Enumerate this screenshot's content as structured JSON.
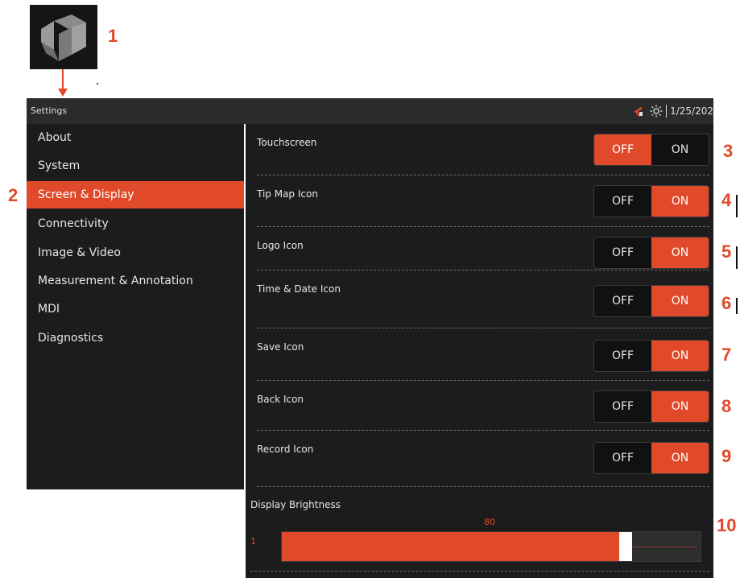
{
  "window": {
    "title": "Settings",
    "date": "1/25/202"
  },
  "callouts": [
    "1",
    "2",
    "3",
    "4",
    "5",
    "6",
    "7",
    "8",
    "9",
    "10"
  ],
  "sidebar": {
    "items": [
      {
        "label": "About"
      },
      {
        "label": "System"
      },
      {
        "label": "Screen & Display",
        "active": true
      },
      {
        "label": "Connectivity"
      },
      {
        "label": "Image & Video"
      },
      {
        "label": "Measurement & Annotation"
      },
      {
        "label": "MDI"
      },
      {
        "label": "Diagnostics"
      }
    ]
  },
  "settings": [
    {
      "label": "Touchscreen",
      "off": "OFF",
      "on": "ON",
      "value": "OFF"
    },
    {
      "label": "Tip Map Icon",
      "off": "OFF",
      "on": "ON",
      "value": "ON"
    },
    {
      "label": "Logo Icon",
      "off": "OFF",
      "on": "ON",
      "value": "ON"
    },
    {
      "label": "Time & Date Icon",
      "off": "OFF",
      "on": "ON",
      "value": "ON"
    },
    {
      "label": "Save Icon",
      "off": "OFF",
      "on": "ON",
      "value": "ON"
    },
    {
      "label": "Back Icon",
      "off": "OFF",
      "on": "ON",
      "value": "ON"
    },
    {
      "label": "Record Icon",
      "off": "OFF",
      "on": "ON",
      "value": "ON"
    }
  ],
  "brightness": {
    "label": "Display Brightness",
    "value": "80",
    "min": "1",
    "max_value": 100
  },
  "icons": {
    "status_1": "probe-gun-icon",
    "status_2": "brightness-sun-icon",
    "logo": "brand-logo-icon"
  },
  "colors": {
    "accent": "#e0492a",
    "panel": "#1c1c1c",
    "titlebar": "#2b2b2b"
  }
}
